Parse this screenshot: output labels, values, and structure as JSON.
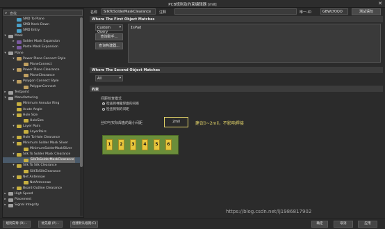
{
  "window": {
    "title": "PCB规则及约束编辑器 [mil]",
    "close_glyph": "✕"
  },
  "search": {
    "placeholder": "查找"
  },
  "tree": [
    {
      "label": "SMD To Plane",
      "type": "rule",
      "color": "#4aa0c8"
    },
    {
      "label": "SMD Neck-Down",
      "type": "rule",
      "color": "#4aa0c8"
    },
    {
      "label": "SMD Entry",
      "type": "rule",
      "color": "#4aa0c8"
    },
    {
      "label": "Mask",
      "type": "category",
      "color": "#a0a0a0",
      "toggle": "▾"
    },
    {
      "label": "Solder Mask Expansion",
      "type": "rule",
      "color": "#7a5aa0",
      "toggle": "▸"
    },
    {
      "label": "Paste Mask Expansion",
      "type": "rule",
      "color": "#7a5aa0",
      "toggle": "▸"
    },
    {
      "label": "Plane",
      "type": "category",
      "color": "#a0a0a0",
      "toggle": "▾"
    },
    {
      "label": "Power Plane Connect Style",
      "type": "rule",
      "color": "#c0a060",
      "toggle": "▾"
    },
    {
      "label": "PlaneConnect",
      "type": "instance",
      "color": "#c0a060"
    },
    {
      "label": "Power Plane Clearance",
      "type": "rule",
      "color": "#c0a060",
      "toggle": "▾"
    },
    {
      "label": "PlaneClearance",
      "type": "instance",
      "color": "#c0a060"
    },
    {
      "label": "Polygon Connect Style",
      "type": "rule",
      "color": "#c0a060",
      "toggle": "▾"
    },
    {
      "label": "PolygonConnect",
      "type": "instance",
      "color": "#c0a060"
    },
    {
      "label": "Testpoint",
      "type": "category",
      "color": "#a0a0a0",
      "toggle": "▸"
    },
    {
      "label": "Manufacturing",
      "type": "category",
      "color": "#a0a0a0",
      "toggle": "▾"
    },
    {
      "label": "Minimum Annular Ring",
      "type": "rule",
      "color": "#c8b040"
    },
    {
      "label": "Acute Angle",
      "type": "rule",
      "color": "#c8b040"
    },
    {
      "label": "Hole Size",
      "type": "rule",
      "color": "#c8b040",
      "toggle": "▾"
    },
    {
      "label": "HoleSize",
      "type": "instance",
      "color": "#c8b040"
    },
    {
      "label": "Layer Pairs",
      "type": "rule",
      "color": "#c8b040",
      "toggle": "▾"
    },
    {
      "label": "LayerPairs",
      "type": "instance",
      "color": "#c8b040"
    },
    {
      "label": "Hole To Hole Clearance",
      "type": "rule",
      "color": "#c8b040",
      "toggle": "▸"
    },
    {
      "label": "Minimum Solder Mask Sliver",
      "type": "rule",
      "color": "#c8b040",
      "toggle": "▾"
    },
    {
      "label": "MinimumSolderMaskSliver",
      "type": "instance",
      "color": "#c8b040"
    },
    {
      "label": "Silk To Solder Mask Clearance",
      "type": "rule",
      "color": "#c8b040",
      "toggle": "▾"
    },
    {
      "label": "SilkToSolderMaskClearance",
      "type": "instance",
      "color": "#c8b040",
      "selected": true
    },
    {
      "label": "Silk To Silk Clearance",
      "type": "rule",
      "color": "#c8b040",
      "toggle": "▾"
    },
    {
      "label": "SilkToSilkClearance",
      "type": "instance",
      "color": "#c8b040"
    },
    {
      "label": "Net Antennae",
      "type": "rule",
      "color": "#c8b040",
      "toggle": "▾"
    },
    {
      "label": "NetAntennae",
      "type": "instance",
      "color": "#c8b040"
    },
    {
      "label": "Board Outline Clearance",
      "type": "rule",
      "color": "#c8b040",
      "toggle": "▸"
    },
    {
      "label": "High Speed",
      "type": "category",
      "color": "#a0a0a0",
      "toggle": "▸"
    },
    {
      "label": "Placement",
      "type": "category",
      "color": "#a0a0a0",
      "toggle": "▸"
    },
    {
      "label": "Signal Integrity",
      "type": "category",
      "color": "#a0a0a0",
      "toggle": "▸"
    }
  ],
  "rule": {
    "name_label": "名称",
    "name_value": "SilkToSolderMaskClearance",
    "comment_label": "注释",
    "comment_value": "",
    "unique_id_label": "唯一-ID",
    "unique_id_value": "GBWLYOQO",
    "test_query_button": "测试语句"
  },
  "first_match": {
    "header": "Where The First Object Matches",
    "dropdown": "Custom Query",
    "helper_button": "查询助手...",
    "builder_button": "查询构建器...",
    "query": "IsPad"
  },
  "second_match": {
    "header": "Where The Second Object Matches",
    "dropdown": "All"
  },
  "constraints": {
    "header": "约束",
    "mode_title": "间距检查模式",
    "option1": "检查到裸露焊盘的间距",
    "option2": "检查到铜的间距",
    "selected_option": "option1",
    "clearance_label": "丝印与实际焊盘的最小间距",
    "clearance_value": "2mil",
    "annotation": "建议0~2mil，不影响焊接",
    "pads": [
      "1",
      "2",
      "3",
      "4",
      "5",
      "6"
    ]
  },
  "bottom": {
    "rule_wizard": "规则向导 (R)...",
    "priorities": "优先级 (P)...",
    "create_default": "创建默认规则(C)",
    "ok": "确定",
    "cancel": "取消",
    "apply": "应用"
  },
  "watermark": "https://blog.csdn.net/lj1986817902"
}
